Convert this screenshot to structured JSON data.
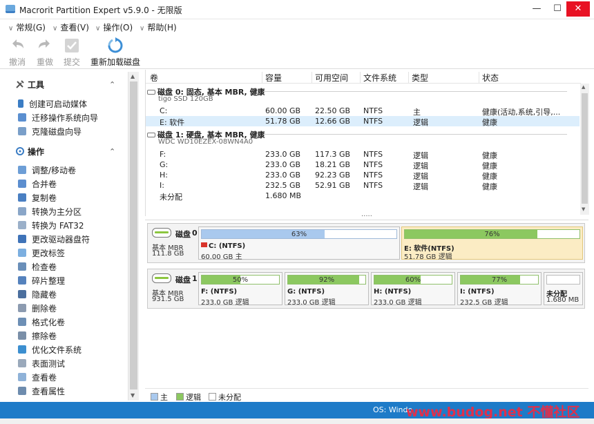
{
  "window": {
    "title": "Macrorit Partition Expert v5.9.0 - 无限版",
    "min": "—",
    "max": "☐",
    "close": "✕"
  },
  "menu": [
    {
      "label": "常规(G)"
    },
    {
      "label": "查看(V)"
    },
    {
      "label": "操作(O)"
    },
    {
      "label": "帮助(H)"
    }
  ],
  "toolbar": {
    "undo": "撤消",
    "redo": "重做",
    "commit": "提交",
    "reload": "重新加载磁盘"
  },
  "sidebar": {
    "tools_title": "工具",
    "tools": [
      "创建可启动媒体",
      "迁移操作系统向导",
      "克隆磁盘向导"
    ],
    "ops_title": "操作",
    "ops": [
      "调整/移动卷",
      "合并卷",
      "复制卷",
      "转换为主分区",
      "转换为 FAT32",
      "更改驱动器盘符",
      "更改标签",
      "检查卷",
      "碎片整理",
      "隐藏卷",
      "删除卷",
      "格式化卷",
      "擦除卷",
      "优化文件系统",
      "表面测试",
      "查看卷",
      "查看属性"
    ]
  },
  "table": {
    "headers": [
      "卷",
      "容量",
      "可用空间",
      "文件系统",
      "类型",
      "状态"
    ],
    "disks": [
      {
        "header": "磁盘 0: 固态, 基本 MBR, 健康",
        "model": "tigo SSD 120GB",
        "rows": [
          {
            "vol": "C:",
            "cap": "60.00 GB",
            "free": "22.50 GB",
            "fs": "NTFS",
            "type": "主",
            "status": "健康(活动,系统,引导,..."
          },
          {
            "vol": "E: 软件",
            "cap": "51.78 GB",
            "free": "12.66 GB",
            "fs": "NTFS",
            "type": "逻辑",
            "status": "健康"
          }
        ]
      },
      {
        "header": "磁盘 1: 硬盘, 基本 MBR, 健康",
        "model": "WDC WD10EZEX-08WN4A0",
        "rows": [
          {
            "vol": "F:",
            "cap": "233.0 GB",
            "free": "117.3 GB",
            "fs": "NTFS",
            "type": "逻辑",
            "status": "健康"
          },
          {
            "vol": "G:",
            "cap": "233.0 GB",
            "free": "18.21 GB",
            "fs": "NTFS",
            "type": "逻辑",
            "status": "健康"
          },
          {
            "vol": "H:",
            "cap": "233.0 GB",
            "free": "92.23 GB",
            "fs": "NTFS",
            "type": "逻辑",
            "status": "健康"
          },
          {
            "vol": "I:",
            "cap": "232.5 GB",
            "free": "52.91 GB",
            "fs": "NTFS",
            "type": "逻辑",
            "status": "健康"
          },
          {
            "vol": "未分配",
            "cap": "1.680 MB",
            "free": "",
            "fs": "",
            "type": "",
            "status": ""
          }
        ]
      }
    ],
    "more": "....."
  },
  "diskmap": [
    {
      "name": "磁盘",
      "num": "0",
      "kind": "基本 MBR",
      "size": "111.8 GB",
      "parts": [
        {
          "pct": "63%",
          "fill": 0.63,
          "name": "C: (NTFS)",
          "info": "60.00 GB 主",
          "kind": "primary"
        },
        {
          "pct": "76%",
          "fill": 0.76,
          "name": "E: 软件(NTFS)",
          "info": "51.78 GB 逻辑",
          "kind": "logical"
        }
      ]
    },
    {
      "name": "磁盘",
      "num": "1",
      "kind": "基本 MBR",
      "size": "931.5 GB",
      "parts": [
        {
          "pct": "50%",
          "fill": 0.5,
          "name": "F: (NTFS)",
          "info": "233.0 GB 逻辑",
          "kind": "logical"
        },
        {
          "pct": "92%",
          "fill": 0.92,
          "name": "G: (NTFS)",
          "info": "233.0 GB 逻辑",
          "kind": "logical"
        },
        {
          "pct": "60%",
          "fill": 0.6,
          "name": "H: (NTFS)",
          "info": "233.0 GB 逻辑",
          "kind": "logical"
        },
        {
          "pct": "77%",
          "fill": 0.77,
          "name": "I: (NTFS)",
          "info": "232.5 GB 逻辑",
          "kind": "logical"
        },
        {
          "name": "未分配",
          "info": "1.680 MB",
          "kind": "unallocated"
        }
      ]
    }
  ],
  "legend": {
    "primary": "主",
    "logical": "逻辑",
    "unallocated": "未分配"
  },
  "status": {
    "os": "OS: Windo",
    "watermark": "www.budog.net 不懂社区"
  },
  "colors": {
    "primary_fill": "#a9c9ee",
    "logical_fill": "#8cc860",
    "selected_bg": "#dceefc",
    "statusbar": "#1e7bc8"
  }
}
